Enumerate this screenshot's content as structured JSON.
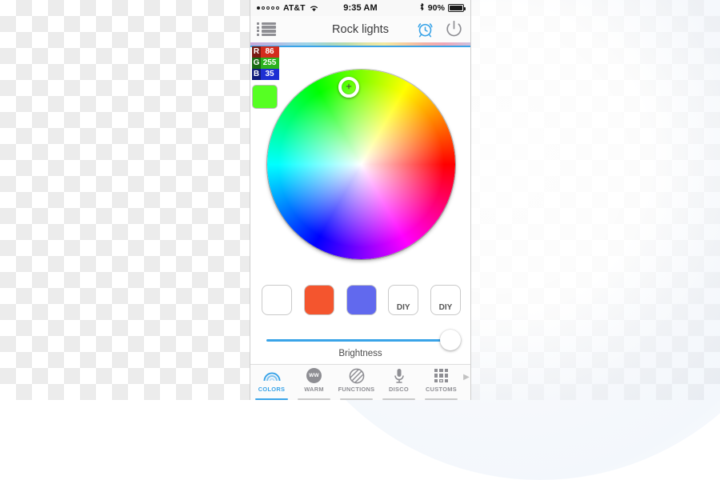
{
  "statusbar": {
    "carrier": "AT&T",
    "signal_dots_filled": 1,
    "signal_dots_total": 5,
    "wifi_icon": "wifi-icon",
    "time": "9:35 AM",
    "bluetooth_icon": "bluetooth-icon",
    "battery_percent": "90%",
    "battery_icon": "battery-icon"
  },
  "navbar": {
    "menu_icon": "list-menu-icon",
    "title": "Rock lights",
    "alarm_icon": "alarm-clock-icon",
    "power_icon": "power-icon",
    "alarm_color": "#3aa4e8",
    "power_color": "#8e8e93"
  },
  "rgb": {
    "rows": [
      {
        "key": "R",
        "value": "86"
      },
      {
        "key": "G",
        "value": "255"
      },
      {
        "key": "B",
        "value": "35"
      }
    ],
    "current_color": "#56ff23"
  },
  "wheel": {
    "name": "color-wheel",
    "selector_icon": "crosshair-icon",
    "selected_color": "#56ff23"
  },
  "presets": [
    {
      "name": "preset-white",
      "label": "",
      "color": "#ffffff"
    },
    {
      "name": "preset-orange",
      "label": "",
      "color": "#f4552e"
    },
    {
      "name": "preset-blue",
      "label": "",
      "color": "#6169ee"
    },
    {
      "name": "preset-diy-1",
      "label": "DIY",
      "color": "#ffffff"
    },
    {
      "name": "preset-diy-2",
      "label": "DIY",
      "color": "#ffffff"
    }
  ],
  "brightness": {
    "label": "Brightness",
    "value": 100,
    "track_color": "#3aa4e8"
  },
  "tabs": [
    {
      "label": "COLORS",
      "icon": "rainbow-arc-icon",
      "active": true
    },
    {
      "label": "WARM",
      "icon": "ww-circle-icon",
      "active": false
    },
    {
      "label": "FUNCTIONS",
      "icon": "striped-circle-icon",
      "active": false
    },
    {
      "label": "DISCO",
      "icon": "microphone-icon",
      "active": false
    },
    {
      "label": "CUSTOMS",
      "icon": "grid-squares-icon",
      "active": false
    }
  ],
  "tab_overflow_icon": "chevron-right-icon",
  "accent_color": "#3aa4e8"
}
